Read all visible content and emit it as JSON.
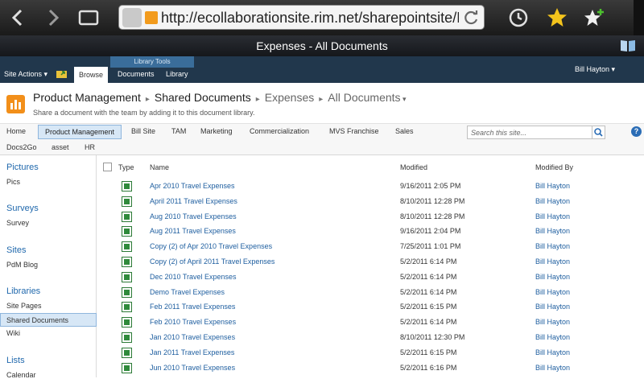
{
  "browser": {
    "url": "http://ecollaborationsite.rim.net/sharepointsite/PdM/S",
    "window_title": "Expenses - All Documents"
  },
  "ribbon": {
    "site_actions": "Site Actions",
    "browse": "Browse",
    "library_tools": "Library Tools",
    "documents": "Documents",
    "library": "Library",
    "user": "Bill Hayton"
  },
  "title_area": {
    "crumbs": [
      "Product Management",
      "Shared Documents",
      "Expenses",
      "All Documents"
    ],
    "description": "Share a document with the team by adding it to this document library."
  },
  "topnav": {
    "row1": [
      "Home",
      "Product Management",
      "Bill Site",
      "TAM",
      "Marketing",
      "Commercialization",
      "MVS Franchise",
      "Sales"
    ],
    "row2": [
      "Docs2Go",
      "asset",
      "HR"
    ],
    "search_placeholder": "Search this site..."
  },
  "leftnav": {
    "sections": [
      {
        "heading": "Pictures",
        "items": [
          "Pics"
        ]
      },
      {
        "heading": "Surveys",
        "items": [
          "Survey"
        ]
      },
      {
        "heading": "Sites",
        "items": [
          "PdM Blog"
        ]
      },
      {
        "heading": "Libraries",
        "items": [
          "Site Pages",
          "Shared Documents",
          "Wiki"
        ]
      },
      {
        "heading": "Lists",
        "items": [
          "Calendar"
        ]
      }
    ]
  },
  "list": {
    "headers": {
      "type": "Type",
      "name": "Name",
      "modified": "Modified",
      "modified_by": "Modified By"
    },
    "rows": [
      {
        "name": "Apr 2010 Travel Expenses",
        "modified": "9/16/2011 2:05 PM",
        "by": "Bill Hayton"
      },
      {
        "name": "April 2011 Travel Expenses",
        "modified": "8/10/2011 12:28 PM",
        "by": "Bill Hayton"
      },
      {
        "name": "Aug 2010 Travel Expenses",
        "modified": "8/10/2011 12:28 PM",
        "by": "Bill Hayton"
      },
      {
        "name": "Aug 2011 Travel Expenses",
        "modified": "9/16/2011 2:04 PM",
        "by": "Bill Hayton"
      },
      {
        "name": "Copy (2) of Apr 2010 Travel Expenses",
        "modified": "7/25/2011 1:01 PM",
        "by": "Bill Hayton"
      },
      {
        "name": "Copy (2) of April 2011 Travel Expenses",
        "modified": "5/2/2011 6:14 PM",
        "by": "Bill Hayton"
      },
      {
        "name": "Dec 2010 Travel Expenses",
        "modified": "5/2/2011 6:14 PM",
        "by": "Bill Hayton"
      },
      {
        "name": "Demo Travel Expenses",
        "modified": "5/2/2011 6:14 PM",
        "by": "Bill Hayton"
      },
      {
        "name": "Feb 2011 Travel Expenses",
        "modified": "5/2/2011 6:15 PM",
        "by": "Bill Hayton"
      },
      {
        "name": "Feb 2010 Travel Expenses",
        "modified": "5/2/2011 6:14 PM",
        "by": "Bill Hayton"
      },
      {
        "name": "Jan 2010 Travel Expenses",
        "modified": "8/10/2011 12:30 PM",
        "by": "Bill Hayton"
      },
      {
        "name": "Jan 2011 Travel Expenses",
        "modified": "5/2/2011 6:15 PM",
        "by": "Bill Hayton"
      },
      {
        "name": "Jun 2010 Travel Expenses",
        "modified": "5/2/2011 6:16 PM",
        "by": "Bill Hayton"
      }
    ]
  }
}
